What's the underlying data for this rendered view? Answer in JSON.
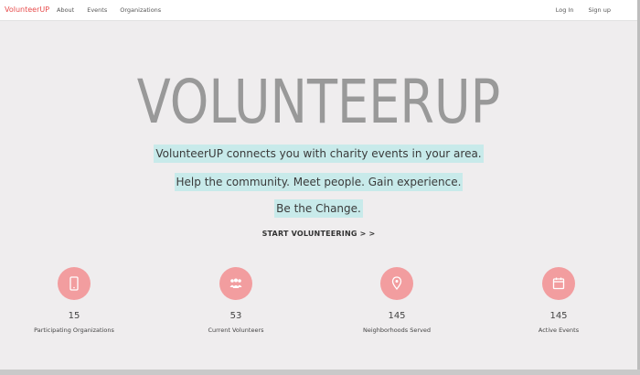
{
  "nav": {
    "brand": "VolunteerUP",
    "links": [
      "About",
      "Events",
      "Organizations"
    ],
    "login": "Log In",
    "signup": "Sign up"
  },
  "hero": {
    "title": "VOLUNTEERUP",
    "line1": "VolunteerUP connects you with charity events in your area.",
    "line2": "Help the community. Meet people. Gain experience.",
    "line3": "Be the Change.",
    "cta": "START VOLUNTEERING > >"
  },
  "stats": [
    {
      "icon": "tablet-icon",
      "value": "15",
      "label": "Participating Organizations"
    },
    {
      "icon": "people-icon",
      "value": "53",
      "label": "Current Volunteers"
    },
    {
      "icon": "map-pin-icon",
      "value": "145",
      "label": "Neighborhoods Served"
    },
    {
      "icon": "calendar-icon",
      "value": "145",
      "label": "Active Events"
    }
  ],
  "colors": {
    "brand": "#e74c4c",
    "highlight": "#c8eaea",
    "stat_circle": "#f29d9f",
    "title": "#999999"
  }
}
